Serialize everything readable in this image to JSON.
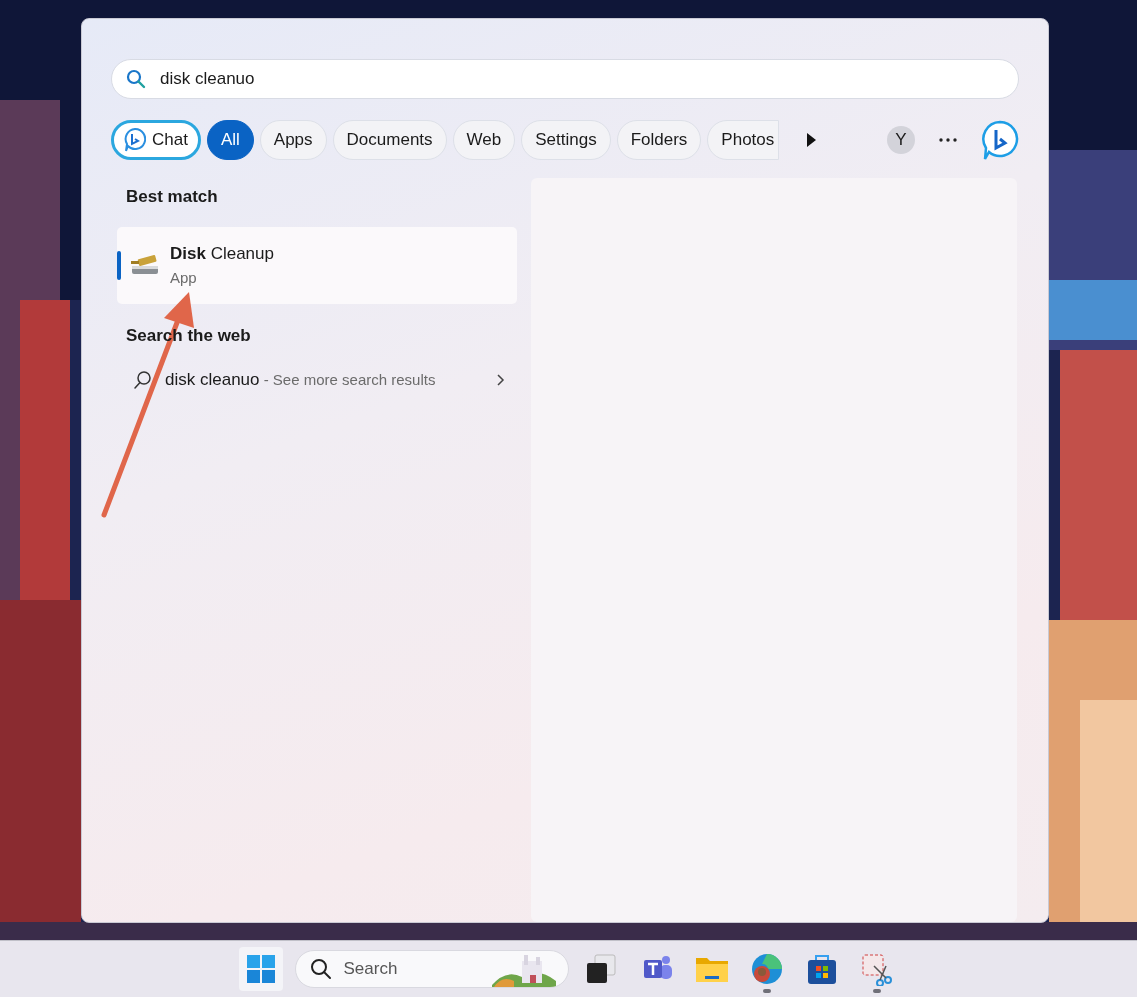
{
  "search": {
    "value": "disk cleanuo"
  },
  "filters": [
    {
      "kind": "chat",
      "label": "Chat",
      "selected": false
    },
    {
      "kind": "chip",
      "label": "All",
      "selected": true
    },
    {
      "kind": "chip",
      "label": "Apps",
      "selected": false
    },
    {
      "kind": "chip",
      "label": "Documents",
      "selected": false
    },
    {
      "kind": "chip",
      "label": "Web",
      "selected": false
    },
    {
      "kind": "chip",
      "label": "Settings",
      "selected": false
    },
    {
      "kind": "chip",
      "label": "Folders",
      "selected": false
    },
    {
      "kind": "chip",
      "label": "Photos",
      "selected": false
    }
  ],
  "account_initial": "Y",
  "best_match": {
    "heading": "Best match",
    "item": {
      "title": "**Disk** Cleanup",
      "subtitle": "App",
      "selected": true
    }
  },
  "web_search": {
    "heading": "Search the web",
    "query": "disk cleanuo",
    "suffix": "- See more search results"
  },
  "taskbar": {
    "search_placeholder": "Search",
    "apps": [
      {
        "kind": "task-view",
        "running": false
      },
      {
        "kind": "teams",
        "running": false
      },
      {
        "kind": "explorer",
        "running": false
      },
      {
        "kind": "edge",
        "running": true
      },
      {
        "kind": "store",
        "running": false
      },
      {
        "kind": "snip",
        "running": true
      }
    ]
  }
}
